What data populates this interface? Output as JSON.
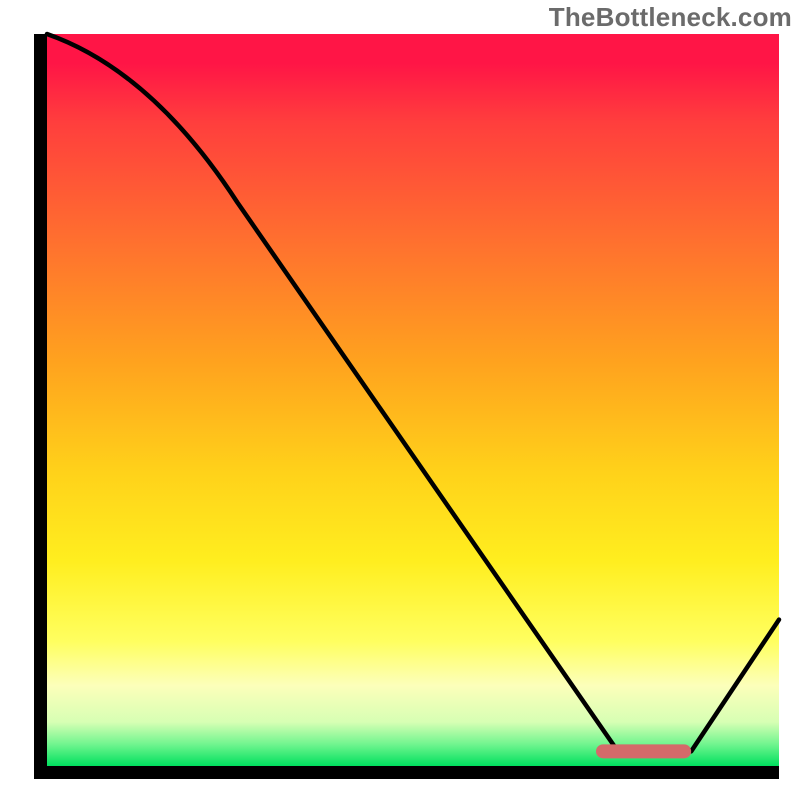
{
  "watermark": "TheBottleneck.com",
  "chart_data": {
    "type": "line",
    "title": "",
    "xlabel": "",
    "ylabel": "",
    "xlim": [
      0,
      100
    ],
    "ylim": [
      0,
      100
    ],
    "series": [
      {
        "name": "curve",
        "x": [
          0,
          26,
          78,
          88,
          100
        ],
        "values": [
          100,
          77,
          2,
          2,
          20
        ]
      }
    ],
    "marker": {
      "x_start": 75,
      "x_end": 88,
      "y": 2,
      "color": "#d46a6a"
    },
    "gradient_stops": [
      {
        "pct": 0,
        "color": "#ff1546"
      },
      {
        "pct": 4,
        "color": "#ff1546"
      },
      {
        "pct": 12,
        "color": "#ff3e3d"
      },
      {
        "pct": 28,
        "color": "#ff6f2f"
      },
      {
        "pct": 45,
        "color": "#ffa31e"
      },
      {
        "pct": 60,
        "color": "#ffd21a"
      },
      {
        "pct": 72,
        "color": "#ffee1f"
      },
      {
        "pct": 83,
        "color": "#ffff60"
      },
      {
        "pct": 89,
        "color": "#fcffba"
      },
      {
        "pct": 94,
        "color": "#d7ffb4"
      },
      {
        "pct": 97,
        "color": "#72f58f"
      },
      {
        "pct": 100,
        "color": "#00e05e"
      }
    ]
  }
}
